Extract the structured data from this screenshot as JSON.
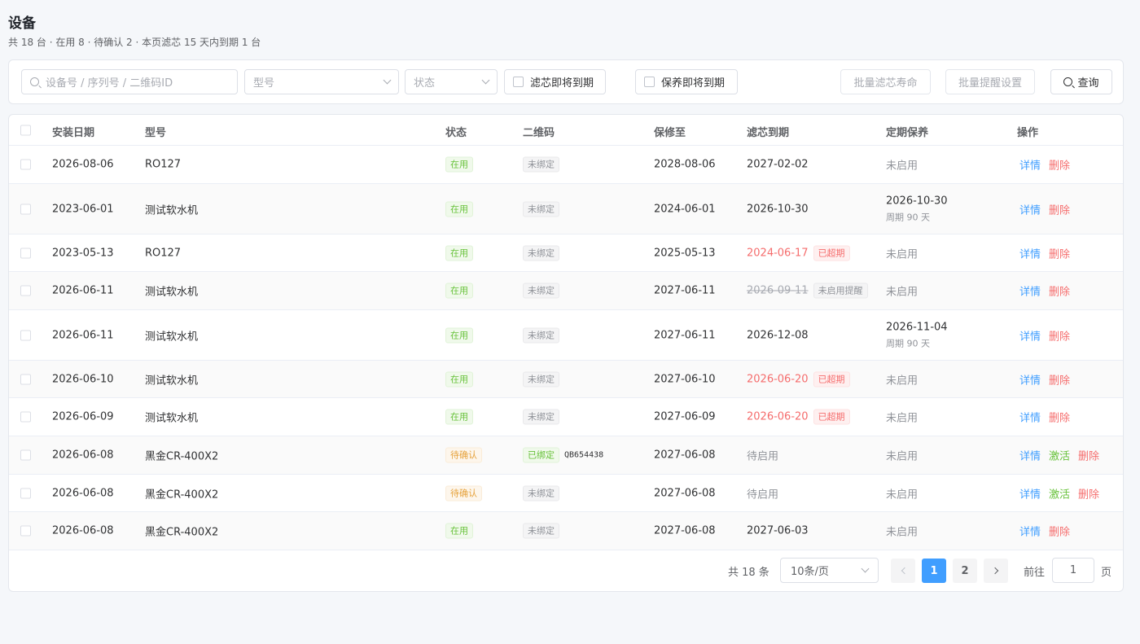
{
  "page": {
    "title": "设备",
    "subtitle": "共 18 台 · 在用 8 · 待确认 2 · 本页滤芯 15 天内到期 1 台"
  },
  "filters": {
    "search_placeholder": "设备号 / 序列号 / 二维码ID",
    "model_placeholder": "型号",
    "status_placeholder": "状态",
    "filter_expiring_label": "滤芯即将到期",
    "maint_expiring_label": "保养即将到期",
    "batch_filter_life_label": "批量滤芯寿命",
    "batch_reminder_label": "批量提醒设置",
    "query_label": "查询"
  },
  "table": {
    "headers": {
      "install_date": "安装日期",
      "model": "型号",
      "status": "状态",
      "qrcode": "二维码",
      "warranty": "保修至",
      "filter_due": "滤芯到期",
      "maintenance": "定期保养",
      "actions": "操作"
    },
    "rows": [
      {
        "install_date": "2026-08-06",
        "model": "RO127",
        "status": "在用",
        "qr_status": "未绑定",
        "qr_code": "",
        "warranty": "2028-08-06",
        "filter_date": "2027-02-02",
        "filter_tag": "",
        "maint": "未启用",
        "maint_sub": "",
        "actions": [
          "详情",
          "删除"
        ]
      },
      {
        "install_date": "2023-06-01",
        "model": "测试软水机",
        "status": "在用",
        "qr_status": "未绑定",
        "qr_code": "",
        "warranty": "2024-06-01",
        "filter_date": "2026-10-30",
        "filter_tag": "",
        "maint": "2026-10-30",
        "maint_sub": "周期 90 天",
        "actions": [
          "详情",
          "删除"
        ]
      },
      {
        "install_date": "2023-05-13",
        "model": "RO127",
        "status": "在用",
        "qr_status": "未绑定",
        "qr_code": "",
        "warranty": "2025-05-13",
        "filter_date": "2024-06-17",
        "filter_tag": "已超期",
        "maint": "未启用",
        "maint_sub": "",
        "actions": [
          "详情",
          "删除"
        ]
      },
      {
        "install_date": "2026-06-11",
        "model": "测试软水机",
        "status": "在用",
        "qr_status": "未绑定",
        "qr_code": "",
        "warranty": "2027-06-11",
        "filter_date": "2026-09-11",
        "filter_tag": "未启用提醒",
        "maint": "未启用",
        "maint_sub": "",
        "actions": [
          "详情",
          "删除"
        ]
      },
      {
        "install_date": "2026-06-11",
        "model": "测试软水机",
        "status": "在用",
        "qr_status": "未绑定",
        "qr_code": "",
        "warranty": "2027-06-11",
        "filter_date": "2026-12-08",
        "filter_tag": "",
        "maint": "2026-11-04",
        "maint_sub": "周期 90 天",
        "actions": [
          "详情",
          "删除"
        ]
      },
      {
        "install_date": "2026-06-10",
        "model": "测试软水机",
        "status": "在用",
        "qr_status": "未绑定",
        "qr_code": "",
        "warranty": "2027-06-10",
        "filter_date": "2026-06-20",
        "filter_tag": "已超期",
        "maint": "未启用",
        "maint_sub": "",
        "actions": [
          "详情",
          "删除"
        ]
      },
      {
        "install_date": "2026-06-09",
        "model": "测试软水机",
        "status": "在用",
        "qr_status": "未绑定",
        "qr_code": "",
        "warranty": "2027-06-09",
        "filter_date": "2026-06-20",
        "filter_tag": "已超期",
        "maint": "未启用",
        "maint_sub": "",
        "actions": [
          "详情",
          "删除"
        ]
      },
      {
        "install_date": "2026-06-08",
        "model": "黑金CR-400X2",
        "status": "待确认",
        "qr_status": "已绑定",
        "qr_code": "QB654438",
        "warranty": "2027-06-08",
        "filter_date": "待启用",
        "filter_tag": "",
        "maint": "未启用",
        "maint_sub": "",
        "actions": [
          "详情",
          "激活",
          "删除"
        ]
      },
      {
        "install_date": "2026-06-08",
        "model": "黑金CR-400X2",
        "status": "待确认",
        "qr_status": "未绑定",
        "qr_code": "",
        "warranty": "2027-06-08",
        "filter_date": "待启用",
        "filter_tag": "",
        "maint": "未启用",
        "maint_sub": "",
        "actions": [
          "详情",
          "激活",
          "删除"
        ]
      },
      {
        "install_date": "2026-06-08",
        "model": "黑金CR-400X2",
        "status": "在用",
        "qr_status": "未绑定",
        "qr_code": "",
        "warranty": "2027-06-08",
        "filter_date": "2027-06-03",
        "filter_tag": "",
        "maint": "未启用",
        "maint_sub": "",
        "actions": [
          "详情",
          "删除"
        ]
      }
    ]
  },
  "pagination": {
    "total": "共 18 条",
    "page_size": "10条/页",
    "pages": [
      "1",
      "2"
    ],
    "current": "1",
    "goto_label": "前往",
    "goto_value": "1",
    "page_unit": "页"
  },
  "colors": {
    "primary": "#409eff",
    "success": "#67c23a",
    "warning": "#e6a23c",
    "danger": "#f56c6c"
  }
}
